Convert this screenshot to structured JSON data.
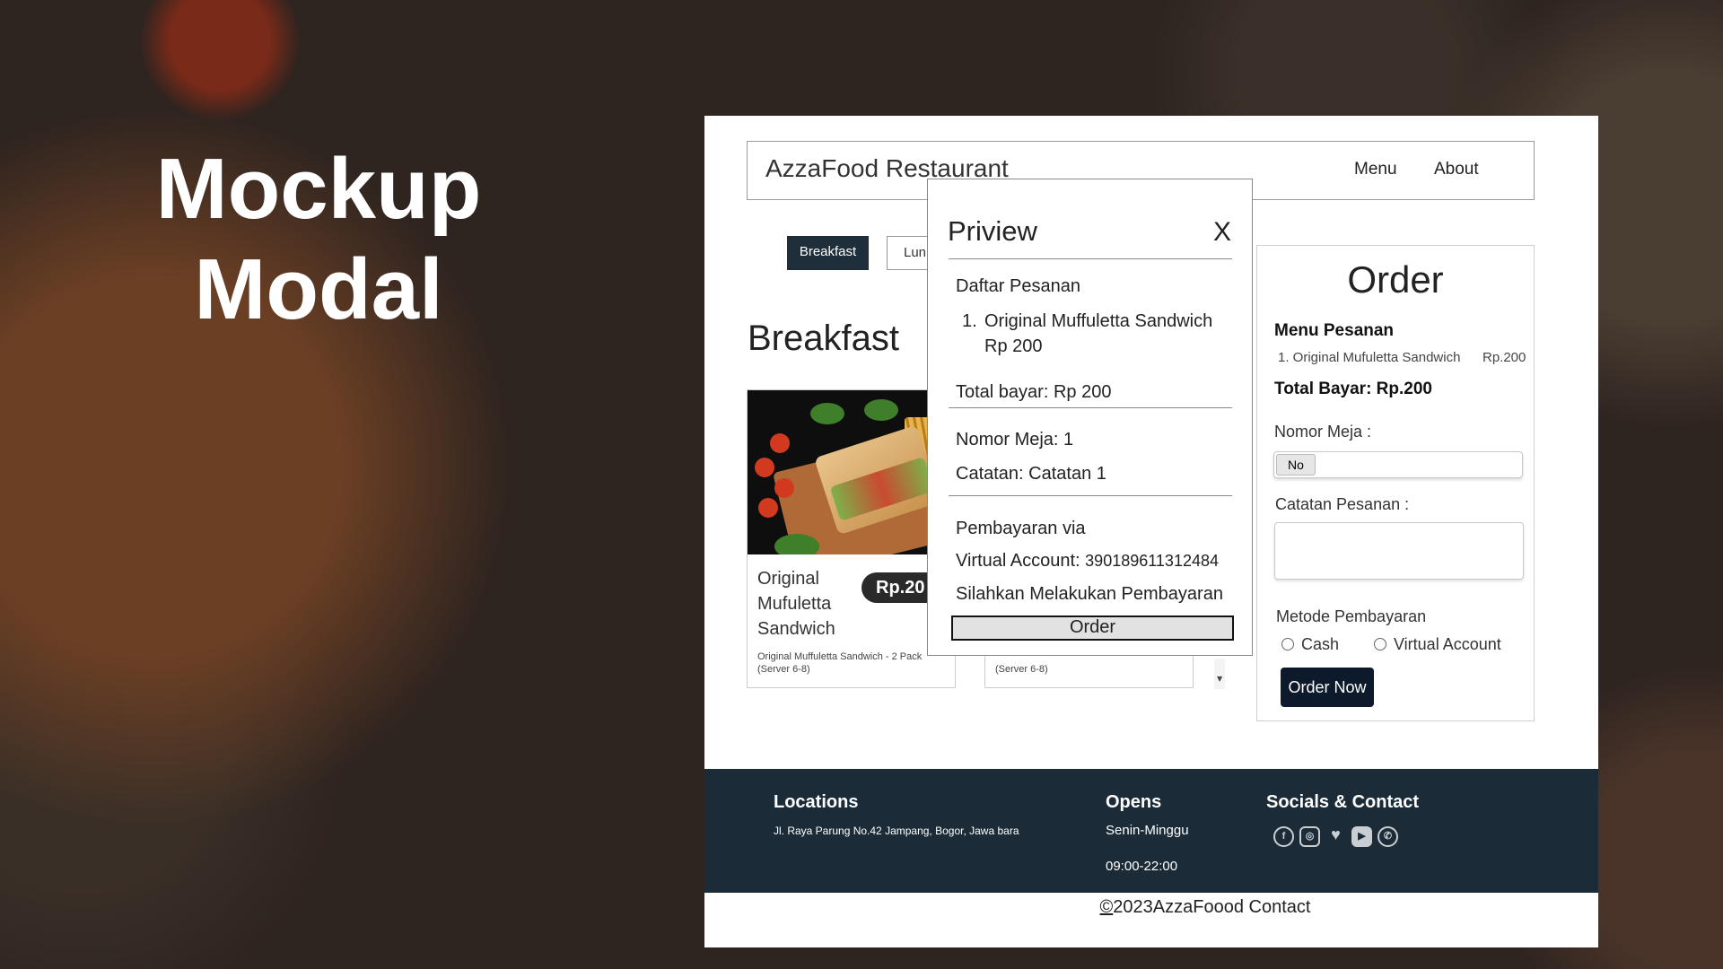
{
  "slide": {
    "title_line1": "Mockup",
    "title_line2": "Modal"
  },
  "navbar": {
    "brand": "AzzaFood Restaurant",
    "links": [
      "Menu",
      "About"
    ]
  },
  "tabs": [
    "Breakfast",
    "Lun"
  ],
  "section": {
    "title": "Breakfast"
  },
  "cards": [
    {
      "name": "Original Mufuletta Sandwich",
      "price": "Rp.20",
      "description": "Original Muffuletta Sandwich - 2 Pack (Server 6-8)"
    },
    {
      "description": "(Server 6-8)"
    }
  ],
  "modal": {
    "title": "Priview",
    "close": "X",
    "list_heading": "Daftar Pesanan",
    "items": [
      {
        "number": "1.",
        "name": "Original Muffuletta Sandwich",
        "price": "Rp 200"
      }
    ],
    "total": "Total bayar: Rp 200",
    "table_number": "Nomor Meja: 1",
    "notes": "Catatan: Catatan 1",
    "payment_heading": "Pembayaran via",
    "va_label": "Virtual Account:",
    "va_number": "390189611312484",
    "instruction": "Silahkan Melakukan Pembayaran",
    "order_button": "Order"
  },
  "order_panel": {
    "title": "Order",
    "menu_heading": "Menu Pesanan",
    "items": [
      {
        "label": "1. Original Mufuletta Sandwich",
        "price": "Rp.200"
      }
    ],
    "total": "Total Bayar: Rp.200",
    "table_label": "Nomor Meja :",
    "table_value": "No",
    "notes_label": "Catatan Pesanan :",
    "notes_value": "",
    "payment_label": "Metode Pembayaran",
    "payment_options": [
      "Cash",
      "Virtual Account"
    ],
    "submit": "Order Now"
  },
  "footer": {
    "locations_heading": "Locations",
    "address": "Jl. Raya Parung No.42 Jampang, Bogor, Jawa bara",
    "opens_heading": "Opens",
    "days": "Senin-Minggu",
    "hours": "09:00-22:00",
    "socials_heading": "Socials & Contact",
    "socials": [
      "facebook-icon",
      "instagram-icon",
      "twitter-icon",
      "youtube-icon",
      "whatsapp-icon"
    ],
    "copyright_symbol": "©",
    "copyright": "2023AzzaFoood Contact"
  },
  "colors": {
    "navy": "#1b2c38",
    "tab_active": "#1e2f3b",
    "order_now": "#0d1a2b",
    "price_pill": "#2a2a2a"
  }
}
